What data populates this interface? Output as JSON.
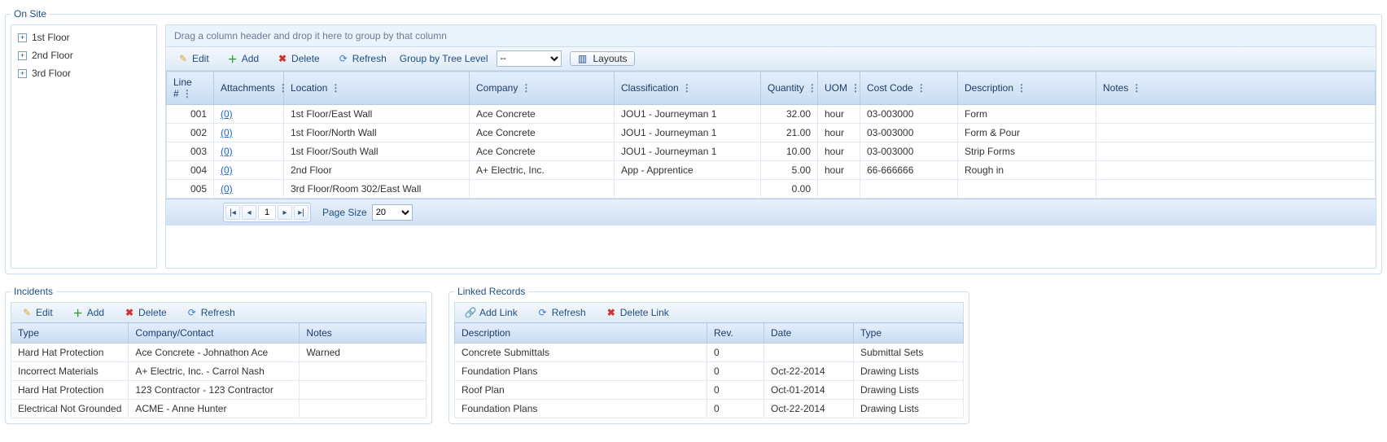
{
  "onsite": {
    "legend": "On Site",
    "tree": [
      "1st Floor",
      "2nd Floor",
      "3rd Floor"
    ],
    "group_hint": "Drag a column header and drop it here to group by that column",
    "toolbar": {
      "edit": "Edit",
      "add": "Add",
      "delete": "Delete",
      "refresh": "Refresh",
      "group_by": "Group by Tree Level",
      "group_by_value": " -- ",
      "layouts": "Layouts"
    },
    "columns": [
      "Line #",
      "Attachments",
      "Location",
      "Company",
      "Classification",
      "Quantity",
      "UOM",
      "Cost Code",
      "Description",
      "Notes"
    ],
    "rows": [
      {
        "line": "001",
        "att": "(0)",
        "loc": "1st Floor/East Wall",
        "company": "Ace Concrete",
        "class": "JOU1 - Journeyman 1",
        "qty": "32.00",
        "uom": "hour",
        "cost": "03-003000",
        "desc": "Form",
        "notes": ""
      },
      {
        "line": "002",
        "att": "(0)",
        "loc": "1st Floor/North Wall",
        "company": "Ace Concrete",
        "class": "JOU1 - Journeyman 1",
        "qty": "21.00",
        "uom": "hour",
        "cost": "03-003000",
        "desc": "Form & Pour",
        "notes": ""
      },
      {
        "line": "003",
        "att": "(0)",
        "loc": "1st Floor/South Wall",
        "company": "Ace Concrete",
        "class": "JOU1 - Journeyman 1",
        "qty": "10.00",
        "uom": "hour",
        "cost": "03-003000",
        "desc": "Strip Forms",
        "notes": ""
      },
      {
        "line": "004",
        "att": "(0)",
        "loc": "2nd Floor",
        "company": "A+ Electric, Inc.",
        "class": "App - Apprentice",
        "qty": "5.00",
        "uom": "hour",
        "cost": "66-666666",
        "desc": "Rough in",
        "notes": ""
      },
      {
        "line": "005",
        "att": "(0)",
        "loc": "3rd Floor/Room 302/East Wall",
        "company": "",
        "class": "",
        "qty": "0.00",
        "uom": "",
        "cost": "",
        "desc": "",
        "notes": ""
      }
    ],
    "pager": {
      "page": "1",
      "page_size_label": "Page Size",
      "page_size_value": "20"
    }
  },
  "incidents": {
    "legend": "Incidents",
    "toolbar": {
      "edit": "Edit",
      "add": "Add",
      "delete": "Delete",
      "refresh": "Refresh"
    },
    "columns": [
      "Type",
      "Company/Contact",
      "Notes"
    ],
    "rows": [
      {
        "type": "Hard Hat Protection",
        "contact": "Ace Concrete - Johnathon Ace",
        "notes": "Warned"
      },
      {
        "type": "Incorrect Materials",
        "contact": "A+ Electric, Inc. - Carrol Nash",
        "notes": ""
      },
      {
        "type": "Hard Hat Protection",
        "contact": "123 Contractor - 123 Contractor",
        "notes": ""
      },
      {
        "type": "Electrical Not Grounded",
        "contact": "ACME - Anne Hunter",
        "notes": ""
      }
    ]
  },
  "linked": {
    "legend": "Linked Records",
    "toolbar": {
      "addlink": "Add Link",
      "refresh": "Refresh",
      "deletelink": "Delete Link"
    },
    "columns": [
      "Description",
      "Rev.",
      "Date",
      "Type"
    ],
    "rows": [
      {
        "desc": "Concrete Submittals",
        "rev": "0",
        "date": "",
        "type": "Submittal Sets"
      },
      {
        "desc": "Foundation Plans",
        "rev": "0",
        "date": "Oct-22-2014",
        "type": "Drawing Lists"
      },
      {
        "desc": "Roof Plan",
        "rev": "0",
        "date": "Oct-01-2014",
        "type": "Drawing Lists"
      },
      {
        "desc": "Foundation Plans",
        "rev": "0",
        "date": "Oct-22-2014",
        "type": "Drawing Lists"
      }
    ]
  }
}
